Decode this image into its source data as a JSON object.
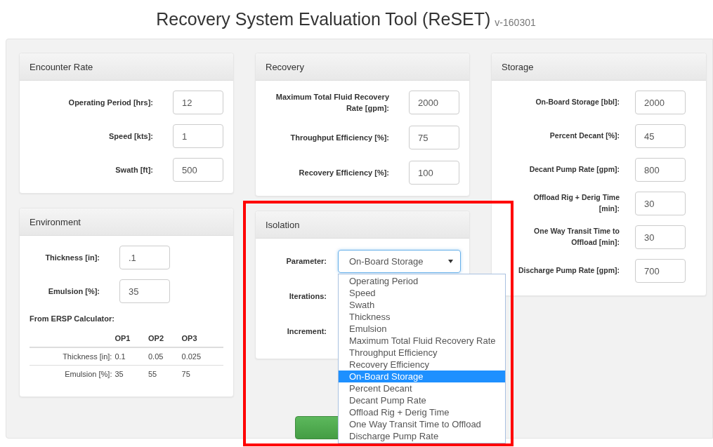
{
  "title": "Recovery System Evaluation Tool (ReSET)",
  "version": "v-160301",
  "encounter_rate": {
    "title": "Encounter Rate",
    "fields": [
      {
        "label": "Operating Period [hrs]:",
        "value": "12"
      },
      {
        "label": "Speed [kts]:",
        "value": "1"
      },
      {
        "label": "Swath [ft]:",
        "value": "500"
      }
    ]
  },
  "environment": {
    "title": "Environment",
    "fields": [
      {
        "label": "Thickness [in]:",
        "value": ".1"
      },
      {
        "label": "Emulsion [%]:",
        "value": "35"
      }
    ],
    "calculator": {
      "title": "From ERSP Calculator:",
      "columns": [
        "OP1",
        "OP2",
        "OP3"
      ],
      "rows": [
        {
          "label": "Thickness [in]:",
          "values": [
            "0.1",
            "0.05",
            "0.025"
          ]
        },
        {
          "label": "Emulsion [%]:",
          "values": [
            "35",
            "55",
            "75"
          ]
        }
      ]
    }
  },
  "recovery": {
    "title": "Recovery",
    "fields": [
      {
        "label": "Maximum Total Fluid Recovery Rate [gpm]:",
        "value": "2000"
      },
      {
        "label": "Throughput Efficiency [%]:",
        "value": "75"
      },
      {
        "label": "Recovery Efficiency [%]:",
        "value": "100"
      }
    ]
  },
  "isolation": {
    "title": "Isolation",
    "parameter": {
      "label": "Parameter:",
      "value": "On-Board Storage",
      "open": true,
      "options": [
        {
          "label": "Operating Period",
          "selected": false
        },
        {
          "label": "Speed",
          "selected": false
        },
        {
          "label": "Swath",
          "selected": false
        },
        {
          "label": "Thickness",
          "selected": false
        },
        {
          "label": "Emulsion",
          "selected": false
        },
        {
          "label": "Maximum Total Fluid Recovery Rate",
          "selected": false
        },
        {
          "label": "Throughput Efficiency",
          "selected": false
        },
        {
          "label": "Recovery Efficiency",
          "selected": false
        },
        {
          "label": "On-Board Storage",
          "selected": true
        },
        {
          "label": "Percent Decant",
          "selected": false
        },
        {
          "label": "Decant Pump Rate",
          "selected": false
        },
        {
          "label": "Offload Rig + Derig Time",
          "selected": false
        },
        {
          "label": "One Way Transit Time to Offload",
          "selected": false
        },
        {
          "label": "Discharge Pump Rate",
          "selected": false
        }
      ]
    },
    "iterations": {
      "label": "Iterations:"
    },
    "increment": {
      "label": "Increment:"
    }
  },
  "storage": {
    "title": "Storage",
    "fields": [
      {
        "label": "On-Board Storage [bbl]:",
        "value": "2000"
      },
      {
        "label": "Percent Decant [%]:",
        "value": "45"
      },
      {
        "label": "Decant Pump Rate [gpm]:",
        "value": "800"
      },
      {
        "label": "Offload Rig + Derig Time [min]:",
        "value": "30"
      },
      {
        "label": "One Way Transit Time to Offload [min]:",
        "value": "30"
      },
      {
        "label": "Discharge Pump Rate [gpm]:",
        "value": "700"
      }
    ]
  },
  "highlight_frame": true
}
